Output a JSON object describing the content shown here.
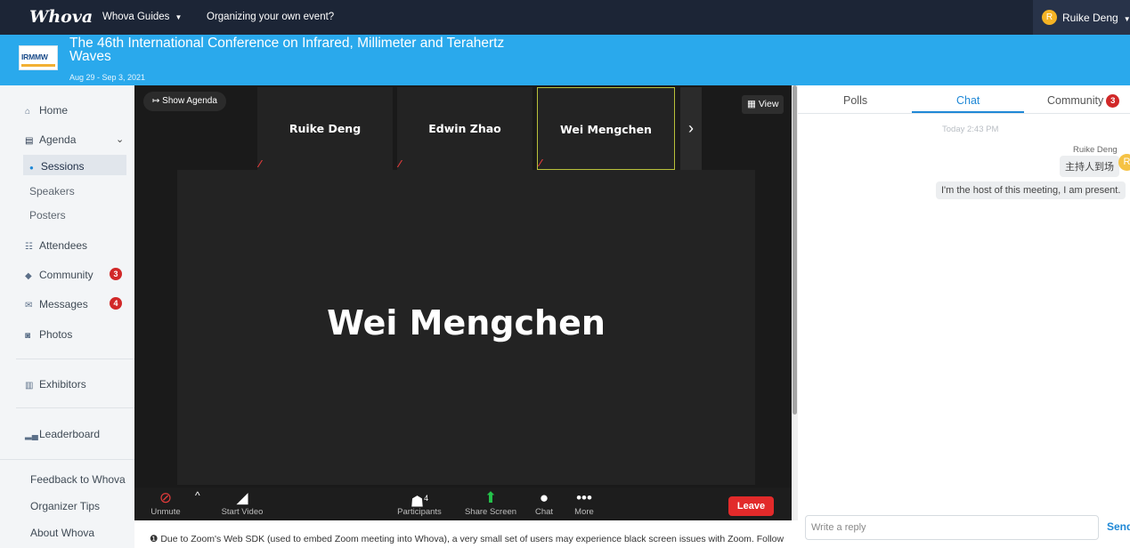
{
  "topnav": {
    "brand": "Whova",
    "guides": "Whova Guides",
    "organizing": "Organizing your own event?",
    "user_initial": "R",
    "user": "Ruike Deng"
  },
  "banner": {
    "logo_text": "IRMMW",
    "title": "The 46th International Conference on Infrared, Millimeter and Terahertz Waves",
    "dates": "Aug 29 - Sep 3, 2021"
  },
  "sidebar": {
    "home": "Home",
    "agenda": "Agenda",
    "sessions": "Sessions",
    "speakers": "Speakers",
    "posters": "Posters",
    "attendees": "Attendees",
    "community": "Community",
    "community_badge": "3",
    "messages": "Messages",
    "messages_badge": "4",
    "photos": "Photos",
    "exhibitors": "Exhibitors",
    "leaderboard": "Leaderboard",
    "feedback": "Feedback to Whova",
    "tips": "Organizer Tips",
    "about": "About Whova"
  },
  "zoom": {
    "show_agenda": "Show Agenda",
    "view": "View",
    "participants": [
      "Ruike Deng",
      "Edwin Zhao",
      "Wei Mengchen"
    ],
    "active_speaker": "Wei Mengchen",
    "toolbar": {
      "unmute": "Unmute",
      "start_video": "Start Video",
      "participants": "Participants",
      "participants_count": "4",
      "share": "Share Screen",
      "chat": "Chat",
      "more": "More",
      "leave": "Leave"
    }
  },
  "notice": "Due to Zoom's Web SDK (used to embed Zoom meeting into Whova), a very small set of users may experience black screen issues with Zoom. Follow",
  "panel": {
    "tabs": {
      "polls": "Polls",
      "chat": "Chat",
      "community": "Community",
      "community_badge": "3"
    },
    "timestamp": "Today 2:43 PM",
    "sender": "Ruike Deng",
    "sender_initial": "R",
    "messages": [
      "主持人到场",
      "I'm the host of this meeting, I am present."
    ],
    "reply_placeholder": "Write a reply",
    "send": "Send"
  }
}
